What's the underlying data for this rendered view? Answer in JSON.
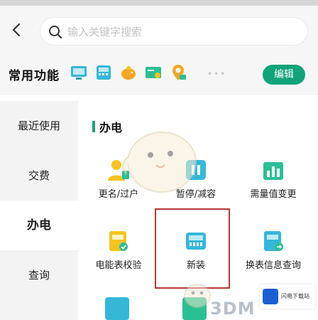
{
  "header": {
    "search_placeholder": "输入关键字搜索"
  },
  "favorites": {
    "title": "常用功能",
    "icons": [
      "monitor-icon",
      "meter-icon",
      "piggy-bank-icon",
      "payment-icon",
      "location-icon"
    ],
    "more": "•••",
    "edit_label": "编辑"
  },
  "sidebar": {
    "items": [
      {
        "label": "最近使用",
        "active": false
      },
      {
        "label": "交费",
        "active": false
      },
      {
        "label": "办电",
        "active": true
      },
      {
        "label": "查询",
        "active": false
      }
    ]
  },
  "content": {
    "section_title": "办电",
    "items": [
      {
        "label": "更名/过户",
        "icon": "person-icon"
      },
      {
        "label": "暂停/减容",
        "icon": "pause-icon"
      },
      {
        "label": "需量值变更",
        "icon": "chart-icon"
      },
      {
        "label": "电能表校验",
        "icon": "meter-check-icon"
      },
      {
        "label": "新装",
        "icon": "new-install-icon"
      },
      {
        "label": "换表信息查询",
        "icon": "meter-swap-icon"
      }
    ]
  },
  "watermark": {
    "text": "3DM",
    "badge_text": "闪电下载站"
  },
  "colors": {
    "accent": "#11a37a",
    "highlight": "#b53838",
    "icon_green": "#2bbf94",
    "icon_yellow": "#f5c321",
    "icon_blue": "#35b7d8"
  }
}
